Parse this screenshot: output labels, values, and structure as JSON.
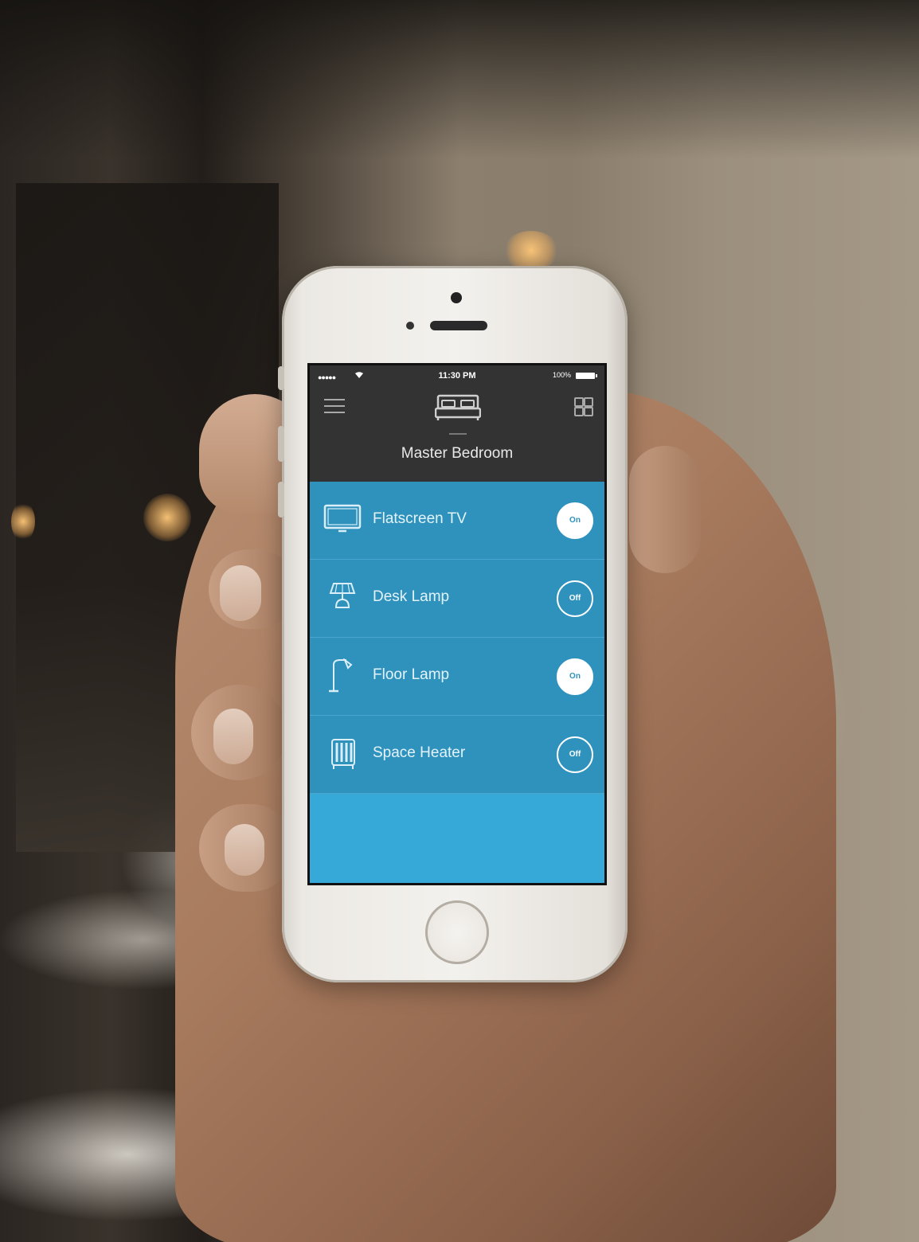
{
  "status_bar": {
    "signal": "●●●●●",
    "wifi_icon": "wifi-icon",
    "time": "11:30 PM",
    "battery": "100%"
  },
  "header": {
    "menu_icon": "hamburger-menu-icon",
    "room_icon": "bed-icon",
    "grid_icon": "grid-icon",
    "room_name": "Master Bedroom"
  },
  "devices": [
    {
      "label": "Flatscreen TV",
      "icon": "tv-icon",
      "state": "On"
    },
    {
      "label": "Desk Lamp",
      "icon": "desk-lamp-icon",
      "state": "Off"
    },
    {
      "label": "Floor Lamp",
      "icon": "floor-lamp-icon",
      "state": "On"
    },
    {
      "label": "Space Heater",
      "icon": "space-heater-icon",
      "state": "Off"
    }
  ],
  "colors": {
    "header_bg": "#333333",
    "row_bg": "#2f92bd",
    "screen_bg": "#37a9d9",
    "toggle_on_bg": "#ffffff"
  }
}
